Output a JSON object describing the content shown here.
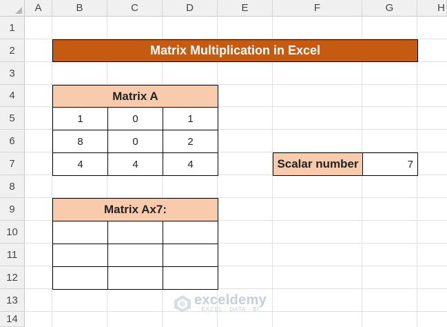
{
  "columns": [
    "A",
    "B",
    "C",
    "D",
    "E",
    "F",
    "G",
    "H"
  ],
  "rows": [
    "1",
    "2",
    "3",
    "4",
    "5",
    "6",
    "7",
    "8",
    "9",
    "10",
    "11",
    "12",
    "13",
    "14"
  ],
  "title": "Matrix Multiplication in Excel",
  "matrix_a": {
    "header": "Matrix A",
    "values": [
      [
        "1",
        "0",
        "1"
      ],
      [
        "8",
        "0",
        "2"
      ],
      [
        "4",
        "4",
        "4"
      ]
    ]
  },
  "scalar": {
    "label": "Scalar number",
    "value": "7"
  },
  "result": {
    "header": "Matrix Ax7:",
    "values": [
      [
        "",
        "",
        ""
      ],
      [
        "",
        "",
        ""
      ],
      [
        "",
        "",
        ""
      ]
    ]
  },
  "watermark": {
    "name": "exceldemy",
    "tagline": "EXCEL · DATA · BI",
    "icon": "exceldemy-logo-icon"
  },
  "colors": {
    "title_fill": "#c55a11",
    "header_fill": "#f8cbad"
  }
}
